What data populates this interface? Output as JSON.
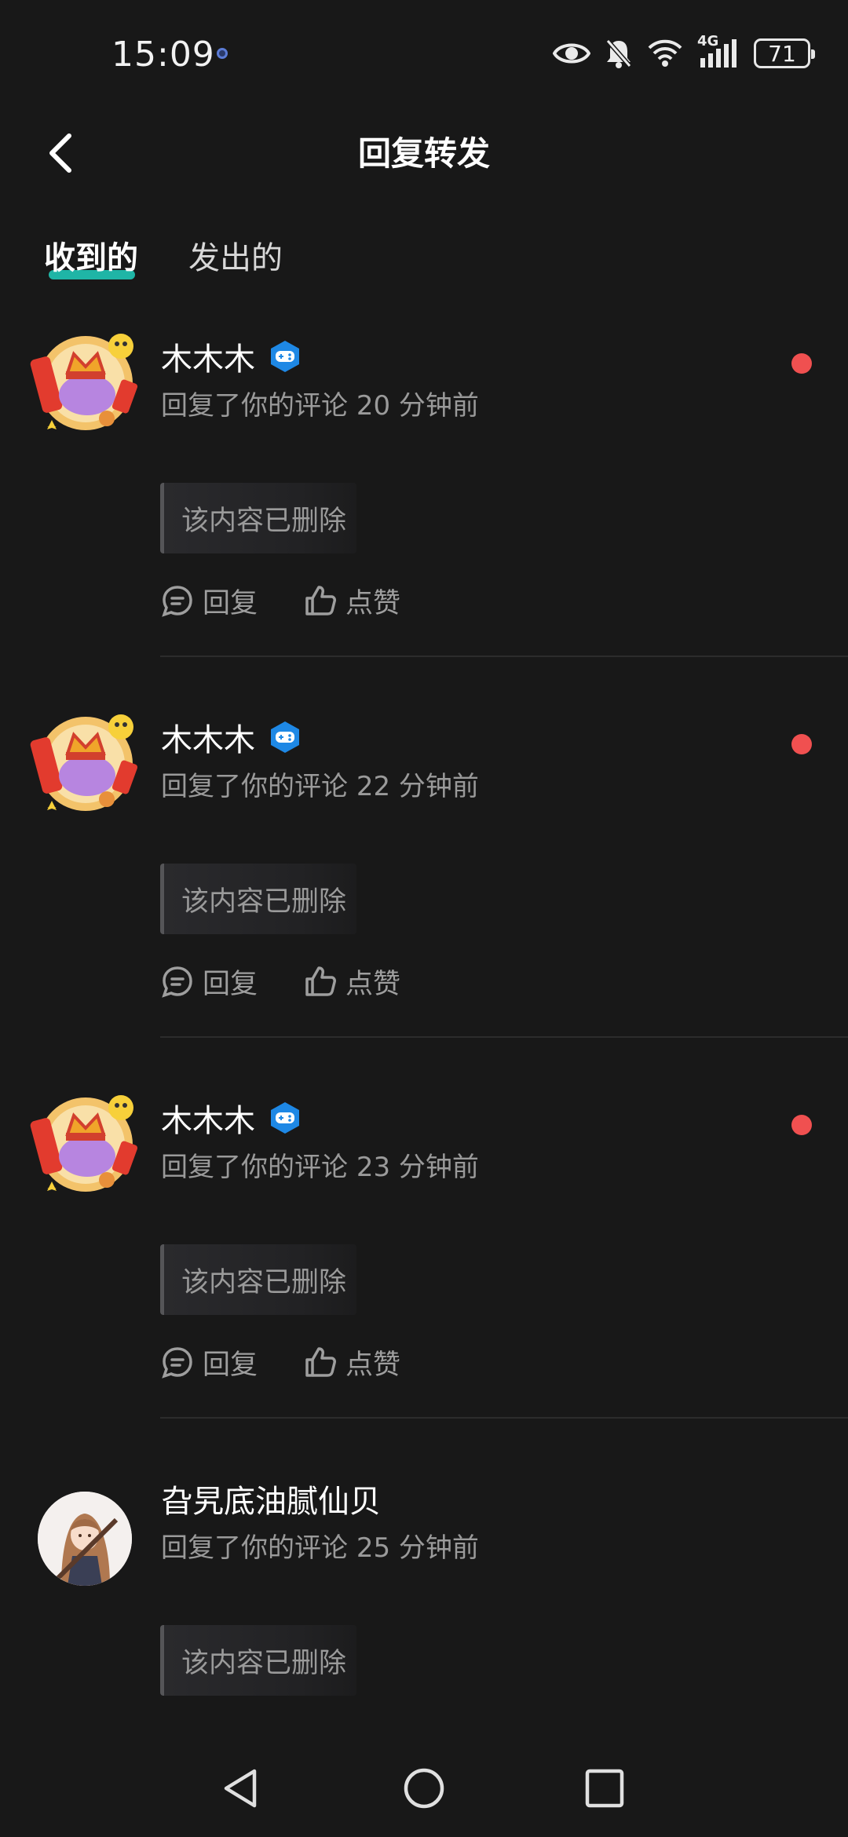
{
  "status_bar": {
    "time": "15:09",
    "network": "4G",
    "battery": "71",
    "icons": [
      "eye-icon",
      "bell-off-icon",
      "wifi-icon",
      "signal-icon",
      "battery-icon"
    ]
  },
  "header": {
    "title": "回复转发",
    "back_icon": "chevron-left-icon"
  },
  "tabs": [
    {
      "label": "收到的",
      "active": true
    },
    {
      "label": "发出的",
      "active": false
    }
  ],
  "notifications": [
    {
      "username": "木木木",
      "badge": "game-controller-badge-icon",
      "action": "回复了你的评论",
      "time": "20 分钟前",
      "unread": true,
      "quote": "该内容已删除",
      "reply_label": "回复",
      "like_label": "点赞"
    },
    {
      "username": "木木木",
      "badge": "game-controller-badge-icon",
      "action": "回复了你的评论",
      "time": "22 分钟前",
      "unread": true,
      "quote": "该内容已删除",
      "reply_label": "回复",
      "like_label": "点赞"
    },
    {
      "username": "木木木",
      "badge": "game-controller-badge-icon",
      "action": "回复了你的评论",
      "time": "23 分钟前",
      "unread": true,
      "quote": "该内容已删除",
      "reply_label": "回复",
      "like_label": "点赞"
    },
    {
      "username": "旮旯底油腻仙贝",
      "action": "回复了你的评论",
      "time": "25 分钟前",
      "unread": false,
      "quote": "该内容已删除"
    }
  ],
  "colors": {
    "background": "#181818",
    "tab_underline": "#1fb5a6",
    "unread_dot": "#f05050",
    "badge": "#1e88e5"
  }
}
